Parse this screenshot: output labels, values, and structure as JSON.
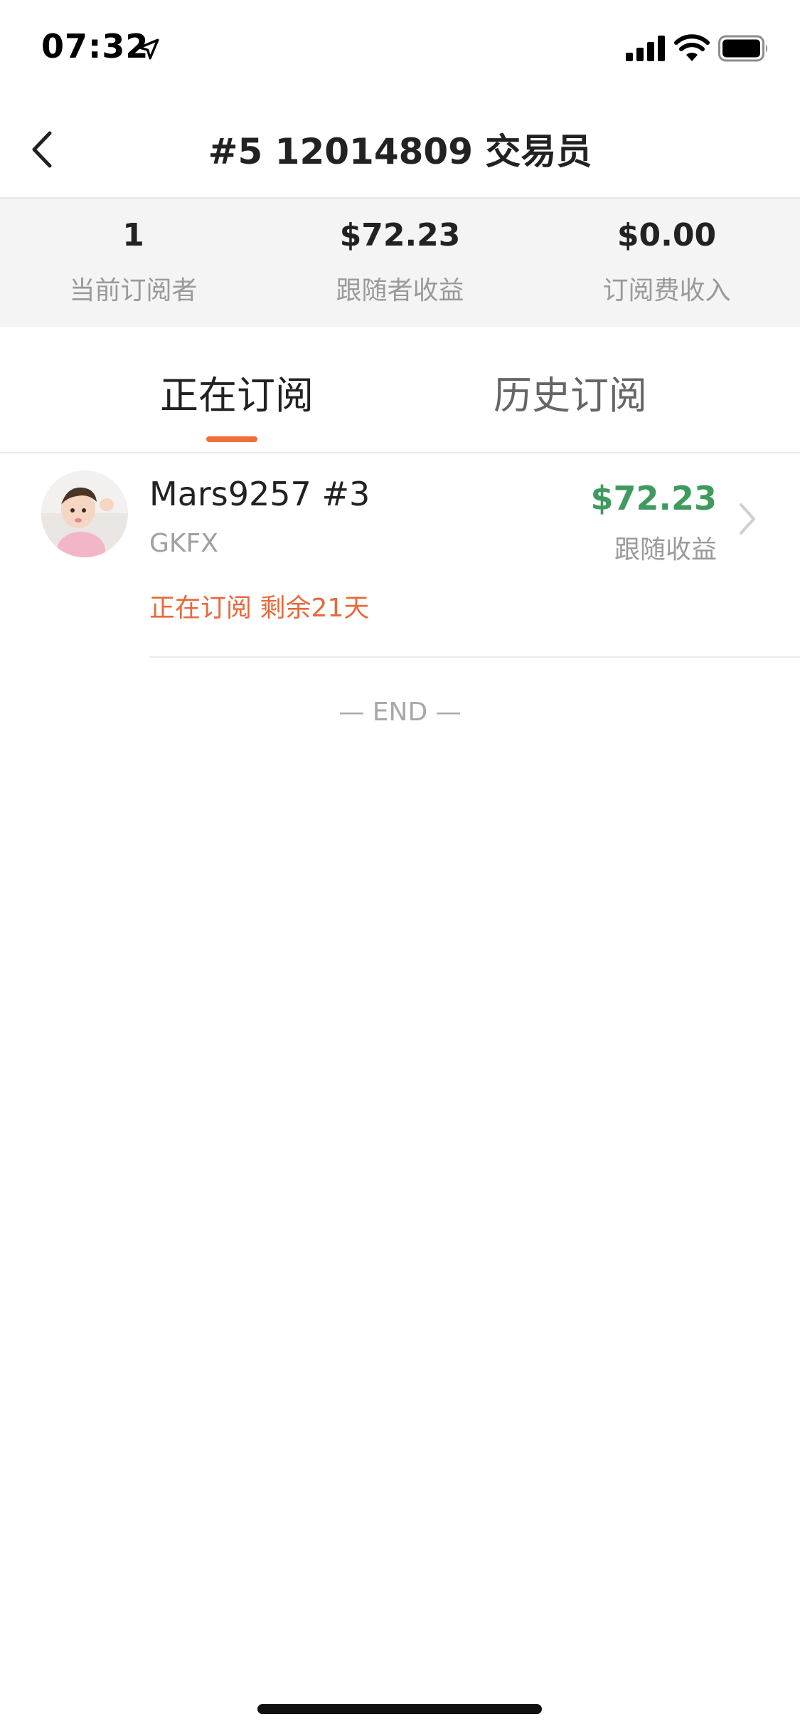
{
  "status_bar": {
    "time": "07:32",
    "icons": [
      "location-arrow-icon",
      "signal-icon",
      "wifi-icon",
      "battery-icon"
    ]
  },
  "nav": {
    "title": "#5 12014809 交易员",
    "back_icon": "chevron-left-icon"
  },
  "stats": [
    {
      "value": "1",
      "label": "当前订阅者"
    },
    {
      "value": "$72.23",
      "label": "跟随者收益"
    },
    {
      "value": "$0.00",
      "label": "订阅费收入"
    }
  ],
  "tabs": [
    {
      "label": "正在订阅",
      "active": true
    },
    {
      "label": "历史订阅",
      "active": false
    }
  ],
  "subscriptions": [
    {
      "name": "Mars9257 #3",
      "broker": "GKFX",
      "status": "正在订阅 剩余21天",
      "profit": "$72.23",
      "profit_label": "跟随收益"
    }
  ],
  "end_text": "— END —",
  "colors": {
    "accent": "#ee6f3a",
    "profit": "#3f9a5e",
    "stats_bg": "#f4f4f4",
    "muted": "#9a9a9a"
  }
}
